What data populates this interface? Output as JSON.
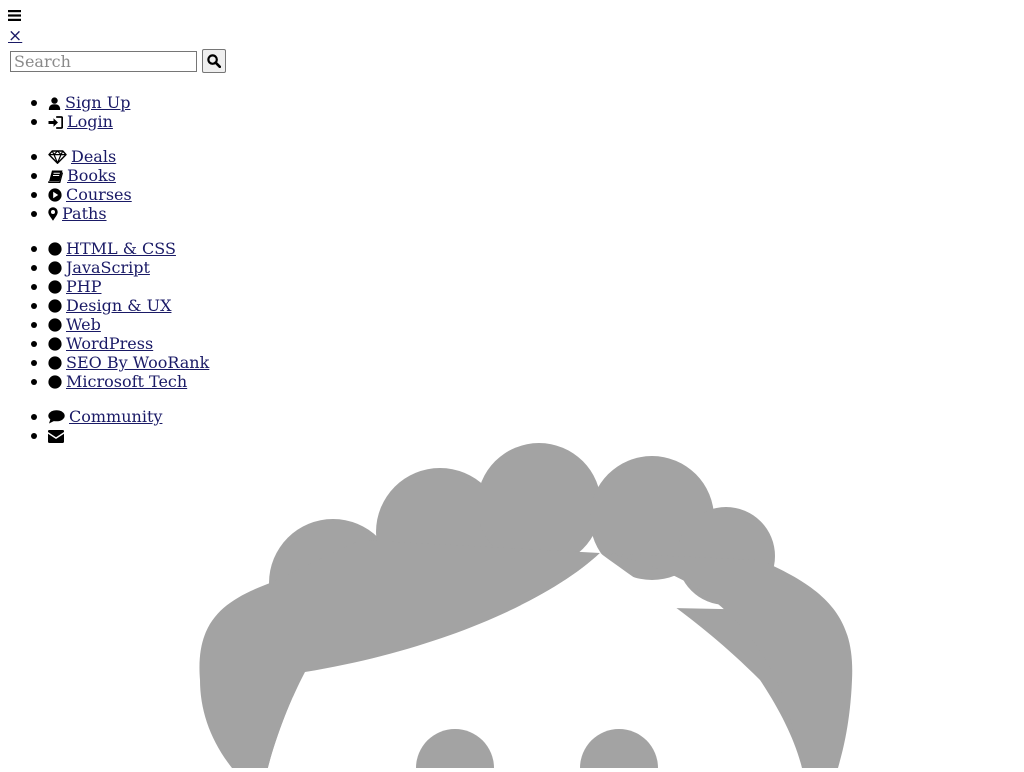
{
  "header": {
    "menu_icon": "hamburger-icon",
    "close_symbol": "×"
  },
  "search": {
    "placeholder": "Search",
    "value": "",
    "button_icon": "search-icon"
  },
  "auth_links": [
    {
      "label": "Sign Up",
      "icon": "user-icon"
    },
    {
      "label": "Login",
      "icon": "sign-in-icon"
    }
  ],
  "main_nav": [
    {
      "label": "Deals",
      "icon": "diamond-icon"
    },
    {
      "label": "Books",
      "icon": "book-icon"
    },
    {
      "label": "Courses",
      "icon": "play-circle-icon"
    },
    {
      "label": "Paths",
      "icon": "map-marker-icon"
    }
  ],
  "categories": [
    {
      "label": "HTML & CSS",
      "icon": "circle-icon"
    },
    {
      "label": "JavaScript",
      "icon": "circle-icon"
    },
    {
      "label": "PHP",
      "icon": "circle-icon"
    },
    {
      "label": "Design & UX",
      "icon": "circle-icon"
    },
    {
      "label": "Web",
      "icon": "circle-icon"
    },
    {
      "label": "WordPress",
      "icon": "circle-icon"
    },
    {
      "label": "SEO By WooRank",
      "icon": "circle-icon"
    },
    {
      "label": "Microsoft Tech",
      "icon": "circle-icon"
    }
  ],
  "misc_nav": [
    {
      "label": "Community",
      "icon": "comment-icon"
    },
    {
      "label": "",
      "icon": "envelope-icon"
    }
  ],
  "avatar": {
    "icon": "default-avatar-illustration",
    "fill_color": "#a3a3a3"
  },
  "colors": {
    "link": "#1a1a66",
    "text": "#000000",
    "background": "#ffffff"
  }
}
